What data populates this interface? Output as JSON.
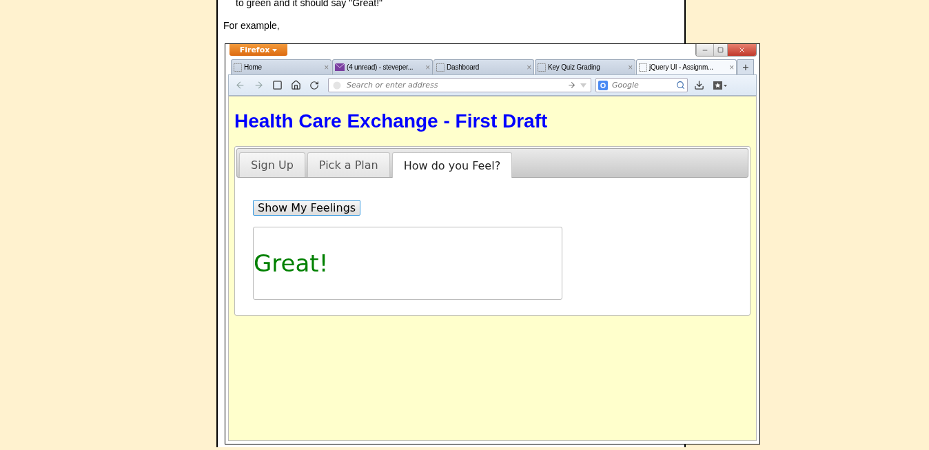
{
  "article": {
    "partial_line": "to green and it should say \"Great!\"",
    "intro": "For example,"
  },
  "browser": {
    "menu_button": "Firefox",
    "tabs": [
      {
        "title": "Home",
        "kind": "blank",
        "selected": false
      },
      {
        "title": "(4 unread) - steveper...",
        "kind": "mail",
        "selected": false
      },
      {
        "title": "Dashboard",
        "kind": "blank",
        "selected": false
      },
      {
        "title": "Key Quiz Grading",
        "kind": "blank",
        "selected": false
      },
      {
        "title": "jQuery UI - Assignm...",
        "kind": "blank",
        "selected": true
      }
    ],
    "new_tab": "+",
    "close_glyph": "×",
    "address": {
      "placeholder": "Search or enter address"
    },
    "search": {
      "placeholder": "Google"
    }
  },
  "page": {
    "heading": "Health Care Exchange - First Draft",
    "tabs": [
      {
        "label": "Sign Up",
        "selected": false
      },
      {
        "label": "Pick a Plan",
        "selected": false
      },
      {
        "label": "How do you Feel?",
        "selected": true
      }
    ],
    "button": "Show My Feelings",
    "result": {
      "text": "Great!",
      "color": "#008000"
    }
  }
}
